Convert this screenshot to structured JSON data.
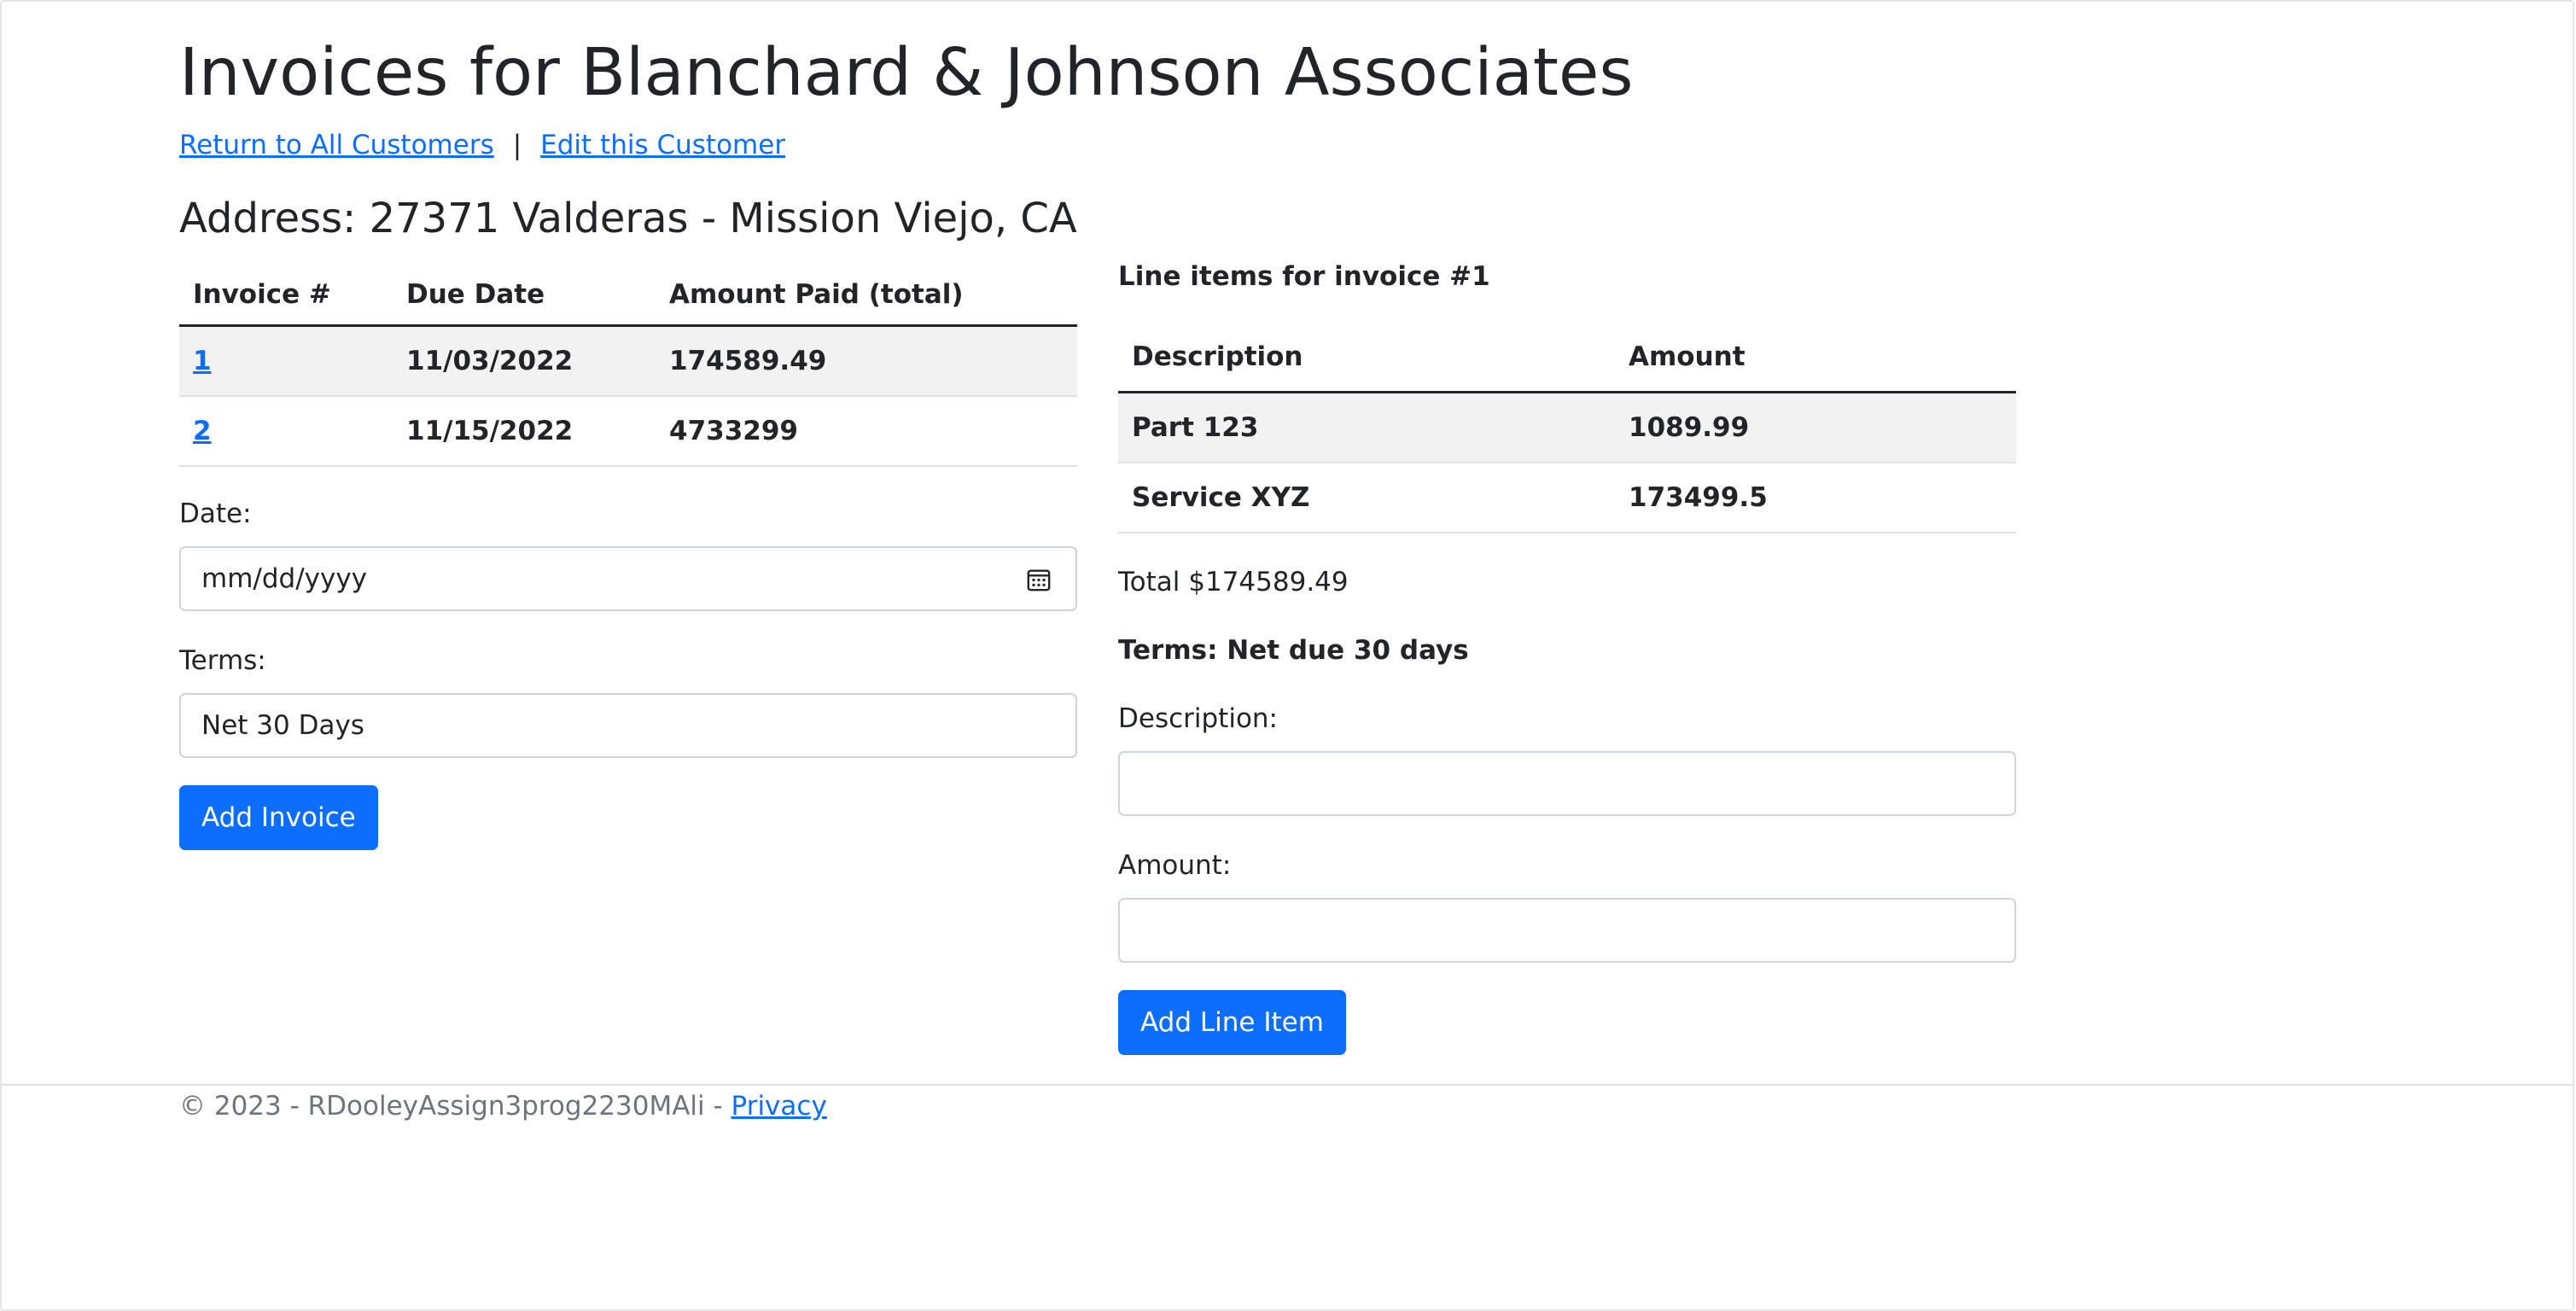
{
  "page": {
    "title": "Invoices for Blanchard & Johnson Associates",
    "nav": {
      "return_link": "Return to All Customers",
      "separator": "|",
      "edit_link": "Edit this Customer"
    },
    "address": "Address: 27371 Valderas - Mission Viejo, CA"
  },
  "invoices": {
    "headers": [
      "Invoice #",
      "Due Date",
      "Amount Paid (total)"
    ],
    "rows": [
      {
        "number": "1",
        "due_date": "11/03/2022",
        "amount_paid": "174589.49"
      },
      {
        "number": "2",
        "due_date": "11/15/2022",
        "amount_paid": "4733299"
      }
    ]
  },
  "invoice_form": {
    "date_label": "Date:",
    "date_placeholder": "mm/dd/yyyy",
    "terms_label": "Terms:",
    "terms_value": "Net 30 Days",
    "submit_label": "Add Invoice"
  },
  "line_items": {
    "heading": "Line items for invoice #1",
    "headers": [
      "Description",
      "Amount"
    ],
    "rows": [
      {
        "description": "Part 123",
        "amount": "1089.99"
      },
      {
        "description": "Service XYZ",
        "amount": "173499.5"
      }
    ],
    "total": "Total $174589.49",
    "terms": "Terms: Net due 30 days"
  },
  "line_item_form": {
    "description_label": "Description:",
    "description_value": "",
    "amount_label": "Amount:",
    "amount_value": "",
    "submit_label": "Add Line Item"
  },
  "footer": {
    "copyright": "© 2023 - RDooleyAssign3prog2230MAli - ",
    "privacy_link": "Privacy"
  },
  "colors": {
    "primary": "#0d6efd",
    "text": "#212529",
    "muted": "#6c757d",
    "stripe": "#f2f2f2",
    "border": "#ced4da"
  },
  "icons": {
    "date_picker": "calendar-icon"
  }
}
